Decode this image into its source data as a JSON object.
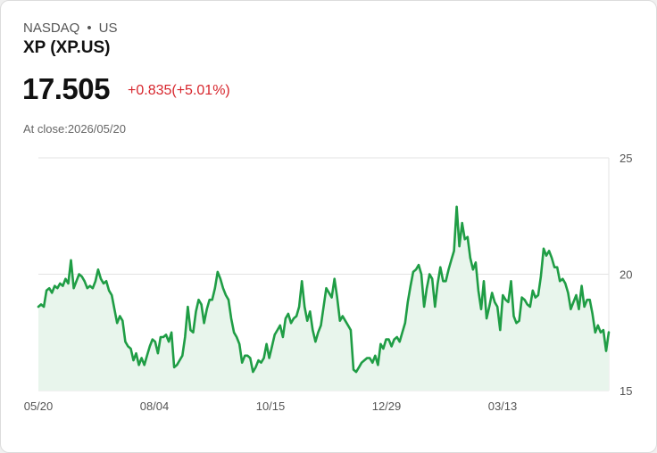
{
  "header": {
    "exchange": "NASDAQ",
    "separator": "•",
    "country": "US",
    "title": "XP (XP.US)",
    "price": "17.505",
    "change": "+0.835(+5.01%)",
    "close_label": "At close:2026/05/20"
  },
  "colors": {
    "line": "#1f9d45",
    "area": "#e8f5ec",
    "change": "#d7262d"
  },
  "chart_data": {
    "type": "area",
    "x_ticks": [
      "05/20",
      "08/04",
      "10/15",
      "12/29",
      "03/13"
    ],
    "y_ticks": [
      "25",
      "20",
      "15"
    ],
    "ylim": [
      15,
      25
    ],
    "grid": true,
    "values": [
      18.6,
      18.7,
      18.6,
      19.3,
      19.4,
      19.2,
      19.5,
      19.4,
      19.6,
      19.5,
      19.8,
      19.6,
      20.6,
      19.4,
      19.7,
      20.0,
      19.9,
      19.7,
      19.4,
      19.5,
      19.4,
      19.7,
      20.2,
      19.8,
      19.6,
      19.7,
      19.3,
      19.1,
      18.5,
      17.9,
      18.2,
      18.0,
      17.1,
      16.9,
      16.8,
      16.3,
      16.6,
      16.1,
      16.4,
      16.1,
      16.5,
      16.9,
      17.2,
      17.1,
      16.6,
      17.3,
      17.3,
      17.4,
      17.1,
      17.5,
      16.0,
      16.1,
      16.3,
      16.5,
      17.3,
      18.6,
      17.6,
      17.5,
      18.4,
      18.9,
      18.7,
      17.9,
      18.5,
      18.9,
      18.9,
      19.4,
      20.1,
      19.8,
      19.4,
      19.1,
      18.9,
      18.1,
      17.5,
      17.3,
      17.0,
      16.2,
      16.5,
      16.5,
      16.4,
      15.8,
      16.0,
      16.3,
      16.2,
      16.4,
      17.0,
      16.4,
      16.9,
      17.4,
      17.6,
      17.8,
      17.3,
      18.1,
      18.3,
      17.9,
      18.1,
      18.2,
      18.6,
      19.7,
      18.6,
      18.0,
      18.4,
      17.6,
      17.1,
      17.5,
      17.8,
      18.6,
      19.4,
      19.2,
      19.0,
      19.8,
      19.0,
      18.0,
      18.2,
      18.0,
      17.8,
      17.6,
      15.9,
      15.8,
      16.0,
      16.2,
      16.3,
      16.4,
      16.4,
      16.2,
      16.5,
      16.1,
      17.0,
      16.8,
      17.2,
      17.2,
      16.9,
      17.2,
      17.3,
      17.1,
      17.5,
      17.9,
      18.8,
      19.5,
      20.1,
      20.2,
      20.4,
      20.0,
      18.6,
      19.4,
      20.0,
      19.8,
      18.6,
      19.6,
      20.3,
      19.7,
      19.7,
      20.2,
      20.6,
      21.0,
      22.9,
      21.2,
      22.2,
      21.5,
      21.6,
      20.7,
      20.2,
      20.5,
      19.3,
      18.5,
      19.7,
      18.1,
      18.6,
      19.2,
      18.8,
      18.6,
      17.6,
      19.1,
      18.9,
      18.8,
      19.7,
      18.2,
      17.9,
      18.0,
      19.0,
      18.9,
      18.7,
      18.6,
      19.3,
      19.0,
      19.1,
      19.9,
      21.1,
      20.8,
      21.0,
      20.7,
      20.3,
      20.3,
      19.7,
      19.8,
      19.6,
      19.2,
      18.5,
      18.8,
      19.1,
      18.5,
      19.5,
      18.6,
      18.9,
      18.9,
      18.3,
      17.5,
      17.8,
      17.5,
      17.6,
      16.7,
      17.505
    ]
  }
}
